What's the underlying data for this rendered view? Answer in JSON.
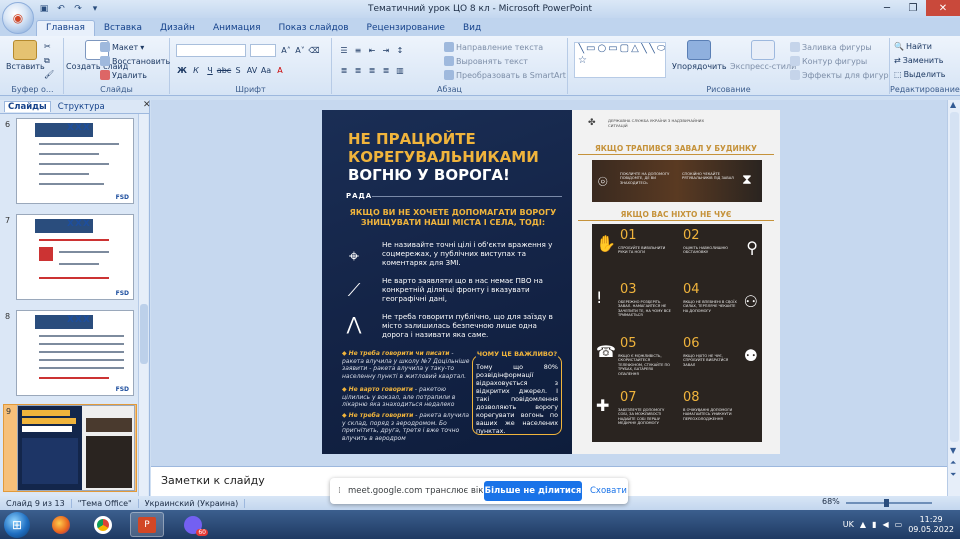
{
  "window": {
    "title": "Тематичний урок ЦО 8 кл - Microsoft PowerPoint"
  },
  "tabs": [
    {
      "label": "Главная",
      "active": true
    },
    {
      "label": "Вставка"
    },
    {
      "label": "Дизайн"
    },
    {
      "label": "Анимация"
    },
    {
      "label": "Показ слайдов"
    },
    {
      "label": "Рецензирование"
    },
    {
      "label": "Вид"
    }
  ],
  "ribbon": {
    "clipboard": {
      "label": "Буфер о...",
      "paste": "Вставить"
    },
    "slides": {
      "label": "Слайды",
      "new_slide": "Создать слайд",
      "layout": "Макет",
      "reset": "Восстановить",
      "delete": "Удалить"
    },
    "font": {
      "label": "Шрифт"
    },
    "paragraph": {
      "label": "Абзац",
      "text_direction": "Направление текста",
      "align_text": "Выровнять текст",
      "smartart": "Преобразовать в SmartArt"
    },
    "drawing": {
      "label": "Рисование",
      "arrange": "Упорядочить",
      "quick_styles": "Экспресс-стили",
      "shape_fill": "Заливка фигуры",
      "shape_outline": "Контур фигуры",
      "shape_effects": "Эффекты для фигур"
    },
    "editing": {
      "label": "Редактирование",
      "find": "Найти",
      "replace": "Заменить",
      "select": "Выделить"
    }
  },
  "leftpanel": {
    "tab_slides": "Слайды",
    "tab_outline": "Структура",
    "thumbnails": [
      {
        "number": "6"
      },
      {
        "number": "7"
      },
      {
        "number": "8"
      },
      {
        "number": "9",
        "selected": true
      }
    ],
    "thumb_logo": "FSD",
    "thumb_mark": "XXX"
  },
  "slide": {
    "title_line1": "НЕ ПРАЦЮЙТЕ",
    "title_line2": "КОРЕГУВАЛЬНИКАМИ",
    "title_line3": "ВОГНЮ У ВОРОГА!",
    "rada": "РАДА",
    "subtitle": "ЯКЩО ВИ НЕ ХОЧЕТЕ ДОПОМАГАТИ ВОРОГУ ЗНИЩУВАТИ НАШІ МІСТА І СЕЛА, ТОДІ:",
    "items": [
      "Не називайте точні цілі і об'єкти враження у соцмережах, у публічних виступах та коментарях для ЗМІ.",
      "Не варто заявляти що в нас немає ПВО на конкретній ділянці фронту і вказувати географічні дані,",
      "Не треба говорити публічно, що для заїзду в місто залишилась безпечною лише одна дорога і називати яка саме."
    ],
    "notes": [
      {
        "bold": "Не треба говорити чи писати",
        "text": "- ракета влучила у школу №7 Доцільніше заявити - ракета влучила у таку-то населенну пункті в житловий квартал."
      },
      {
        "bold": "Не варто говорити",
        "text": "- ракетою цілились у вокзал, але потрапили в лікарню яка знаходиться недалеко"
      },
      {
        "bold": "Не треба говорити",
        "text": "- ракета влучила у склад, поряд з аеродромом. Бо пригнітить, друга, третя і вже точно влучить в аеродром"
      }
    ],
    "why_title": "ЧОМУ ЦЕ ВАЖЛИВО?",
    "why_text": "Тому що 80% розвідінформації відраховується з відкритих джерел. І такі повідомлення дозволяють ворогу корегувати вогонь по ваших же населених пунктах.",
    "org": "ДЕРЖАВНА СЛУЖБА УКРАЇНИ З НАДЗВИЧАЙНИХ СИТУАЦІЙ",
    "header_collapse": "ЯКЩО ТРАПИВСЯ ЗАВАЛ У БУДИНКУ",
    "collapse_text_a": "ПОКЛИЧТЕ НА ДОПОМОГУ ПОВІДОМТЕ, ДЕ ВИ ЗНАХОДИТЕСЬ",
    "collapse_text_b": "СПОКІЙНО ЧЕКАЙТЕ РЯТУВАЛЬНИКІВ ПІД ЗАВАЛ",
    "header_nobody": "ЯКЩО ВАС НІХТО НЕ ЧУЄ",
    "steps": [
      {
        "num": "01",
        "text": "СПРОБУЙТЕ ВИВІЛЬНИТИ РУКИ ТА НОГИ"
      },
      {
        "num": "02",
        "text": "ОЦІНІТЬ НАВКОЛИШНЮ ОБСТАНОВКУ"
      },
      {
        "num": "03",
        "text": "ОБЕРЕЖНО РОЗБЕРІТЬ ЗАВАЛ. НАМАГАЙТЕСЯ НЕ ЗАЧЕПИТИ ТЕ, НА ЧОМУ ВСЕ ТРИМАЄТЬСЯ"
      },
      {
        "num": "04",
        "text": "ЯКЩО НЕ ВПЕВНЕНІ В СВОЇХ СИЛАХ, ТЕРПЛЯЧЕ ЧЕКАЙТЕ НА ДОПОМОГУ"
      },
      {
        "num": "05",
        "text": "ЯКЩО Є МОЖЛИВІСТЬ, СКОРИСТАЙТЕСЯ ТЕЛЕФОНОМ, СТУКАЙТЕ ПО ТРУБАХ, БАТАРЕЯХ ОПАЛЕННЯ"
      },
      {
        "num": "06",
        "text": "ЯКЩО НІХТО НЕ ЧУЄ, СПРОБУЙТЕ ВИБРАТИСЯ ЗАВАЛ"
      },
      {
        "num": "07",
        "text": "ЗАБЕЗПЕЧТЕ ДОПОМОГУ СОБІ, ЗА МОЖЛИВОСТІ НАДАЙТЕ СОБІ ПЕРШУ МЕДИЧНУ ДОПОМОГУ"
      },
      {
        "num": "08",
        "text": "В ОЧІКУВАННІ ДОПОМОГИ НАМАГАЙТЕСЬ УНИКНУТИ ПЕРЕОХОЛОДЖЕННЯ"
      }
    ]
  },
  "notes_pane": {
    "placeholder": "Заметки к слайду"
  },
  "statusbar": {
    "slide_counter": "Слайд 9 из 13",
    "theme": "\"Тема Office\"",
    "language": "Украинский (Украина)",
    "zoom": "68%"
  },
  "sharebar": {
    "message": "meet.google.com транслює вікно.",
    "stop_button": "Більше не ділитися",
    "hide_button": "Сховати"
  },
  "taskbar": {
    "lang": "UK",
    "time": "11:29",
    "date": "09.05.2022",
    "viber_badge": "60"
  }
}
